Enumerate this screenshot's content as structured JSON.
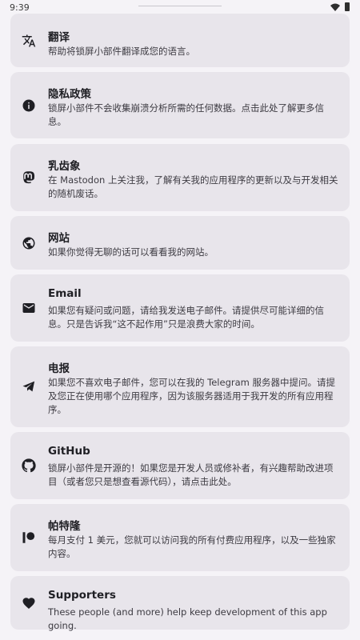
{
  "status_bar": {
    "time": "9:39"
  },
  "items": [
    {
      "key": "translate",
      "title": "翻译",
      "desc": "帮助将锁屏小部件翻译成您的语言。",
      "icon": "translate-icon"
    },
    {
      "key": "privacy",
      "title": "隐私政策",
      "desc": "锁屏小部件不会收集崩溃分析所需的任何数据。点击此处了解更多信息。",
      "icon": "info-icon"
    },
    {
      "key": "mastodon",
      "title": "乳齿象",
      "desc": "在 Mastodon 上关注我，了解有关我的应用程序的更新以及与开发相关的随机废话。",
      "icon": "mastodon-icon"
    },
    {
      "key": "website",
      "title": "网站",
      "desc": "如果你觉得无聊的话可以看看我的网站。",
      "icon": "globe-icon"
    },
    {
      "key": "email",
      "title": "Email",
      "desc": "如果您有疑问或问题，请给我发送电子邮件。请提供尽可能详细的信息。只是告诉我“这不起作用”只是浪费大家的时间。",
      "icon": "mail-icon"
    },
    {
      "key": "telegram",
      "title": "电报",
      "desc": "如果您不喜欢电子邮件，您可以在我的 Telegram 服务器中提问。请提及您正在使用哪个应用程序，因为该服务器适用于我开发的所有应用程序。",
      "icon": "telegram-icon"
    },
    {
      "key": "github",
      "title": "GitHub",
      "desc": "锁屏小部件是开源的！如果您是开发人员或修补者，有兴趣帮助改进项目（或者您只是想查看源代码），请点击此处。",
      "icon": "github-icon"
    },
    {
      "key": "patreon",
      "title": "帕特隆",
      "desc": "每月支付 1 美元，您就可以访问我的所有付费应用程序，以及一些独家内容。",
      "icon": "patreon-icon"
    },
    {
      "key": "supporters",
      "title": "Supporters",
      "desc": "These people (and more) help keep development of this app going.",
      "icon": "heart-icon"
    }
  ]
}
